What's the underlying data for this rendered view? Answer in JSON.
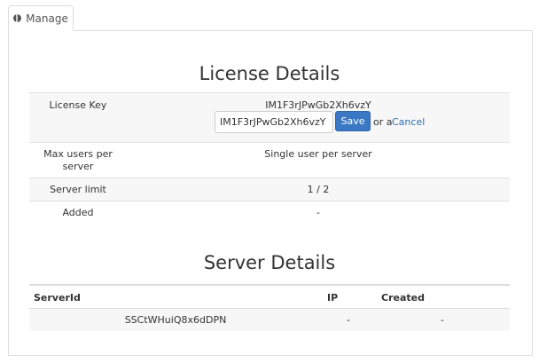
{
  "tab": {
    "label": "Manage",
    "icon": "globe-icon"
  },
  "license": {
    "title": "License Details",
    "rows": [
      {
        "label": "License Key",
        "value": "IM1F3rJPwGb2Xh6vzY"
      },
      {
        "label": "Max users per server",
        "value": "Single user per server"
      },
      {
        "label": "Server limit",
        "value": "1 / 2"
      },
      {
        "label": "Added",
        "value": "-"
      }
    ],
    "edit": {
      "input_value": "IM1F3rJPwGb2Xh6vzY",
      "save_label": "Save",
      "or_text": "or a",
      "cancel_label": "Cancel"
    }
  },
  "server": {
    "title": "Server Details",
    "headers": [
      "ServerId",
      "IP",
      "Created"
    ],
    "rows": [
      {
        "server_id": "SSCtWHuiQ8x6dDPN",
        "ip": "-",
        "created": "-"
      }
    ]
  },
  "colors": {
    "accent": "#3a78c5",
    "link": "#2a6fb5",
    "stripe": "#f7f7f7"
  }
}
